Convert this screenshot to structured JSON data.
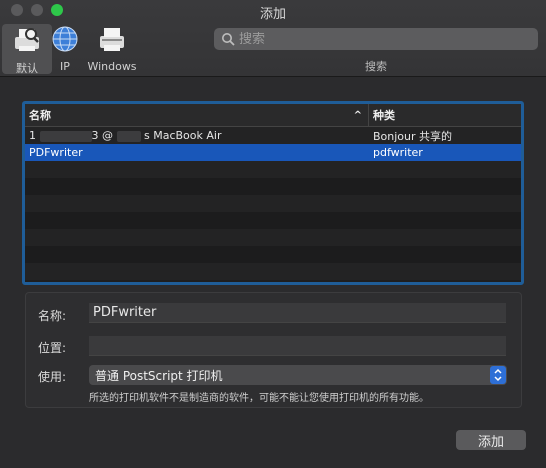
{
  "window": {
    "title": "添加"
  },
  "toolbar": {
    "tabs": [
      {
        "label": "默认",
        "icon": "default-printer-icon",
        "selected": true
      },
      {
        "label": "IP",
        "icon": "globe-network-icon",
        "selected": false
      },
      {
        "label": "Windows",
        "icon": "windows-printer-icon",
        "selected": false
      }
    ],
    "search": {
      "placeholder": "搜索",
      "caption": "搜索"
    }
  },
  "printer_list": {
    "columns": {
      "name": "名称",
      "kind": "种类"
    },
    "rows": [
      {
        "name_prefix": "1",
        "name_mid": "3 @",
        "name_suffix": "s MacBook Air",
        "kind": "Bonjour 共享的",
        "selected": false
      },
      {
        "name": "PDFwriter",
        "kind": "pdfwriter",
        "selected": true
      }
    ]
  },
  "form": {
    "name_label": "名称:",
    "name_value": "PDFwriter",
    "location_label": "位置:",
    "location_value": "",
    "use_label": "使用:",
    "use_value": "普通 PostScript 打印机",
    "note": "所选的打印机软件不是制造商的软件，可能不能让您使用打印机的所有功能。"
  },
  "actions": {
    "add_label": "添加"
  },
  "colors": {
    "selection": "#1957b9",
    "list_border": "#1f5d98",
    "zoom_green": "#2ec84a"
  }
}
